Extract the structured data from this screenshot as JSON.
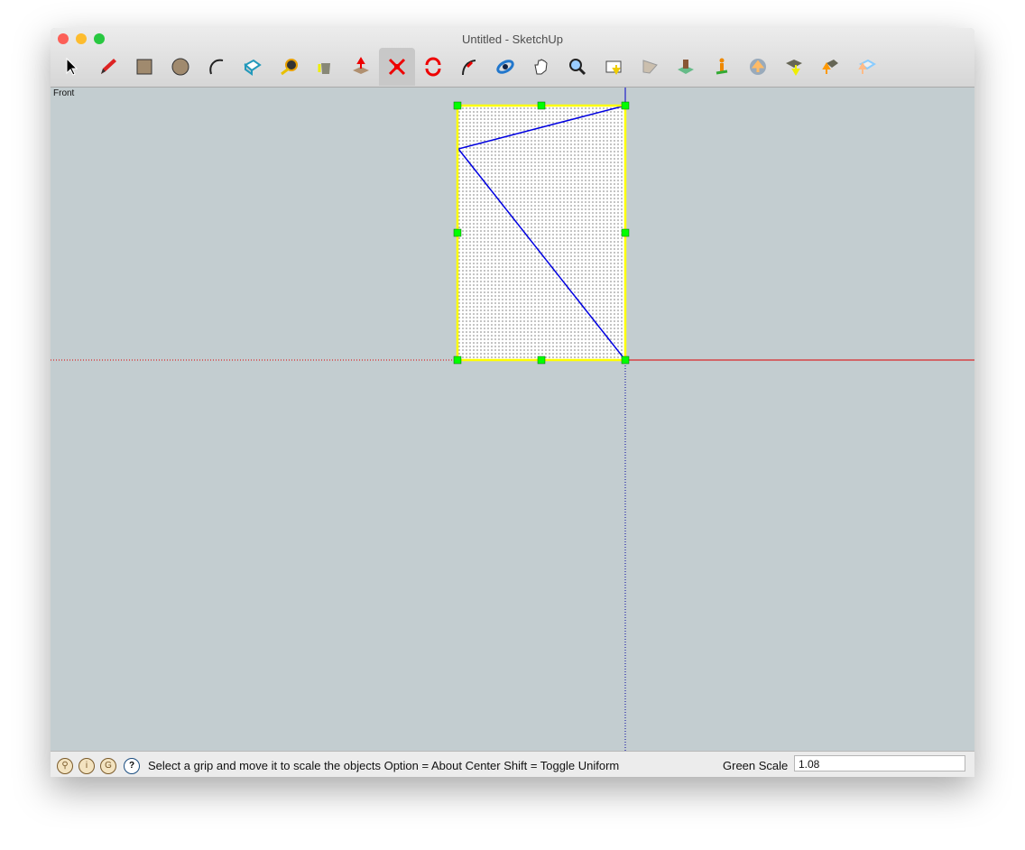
{
  "window": {
    "title": "Untitled - SketchUp"
  },
  "toolbar": {
    "selected": "scale",
    "tools": [
      "select",
      "pencil",
      "rectangle",
      "circle",
      "arc",
      "make-component",
      "tape-measure",
      "paint-bucket",
      "push-pull",
      "scale",
      "rotate",
      "follow-me",
      "orbit",
      "pan",
      "zoom",
      "get-models",
      "preview-model",
      "add-location",
      "add-3d-building",
      "toggle-terrain",
      "get-models-warehouse",
      "share-model",
      "share-component"
    ]
  },
  "viewport": {
    "view_label": "Front"
  },
  "status": {
    "message": "Select a grip and move it to scale the objects  Option = About Center  Shift = Toggle Uniform",
    "vcb_label": "Green Scale",
    "vcb_value": "1.08"
  },
  "colors": {
    "red_axis": "#e00000",
    "blue_axis": "#0000c8",
    "selection": "#ffff00",
    "grip": "#00ff00",
    "background": "#c3cdd0"
  }
}
